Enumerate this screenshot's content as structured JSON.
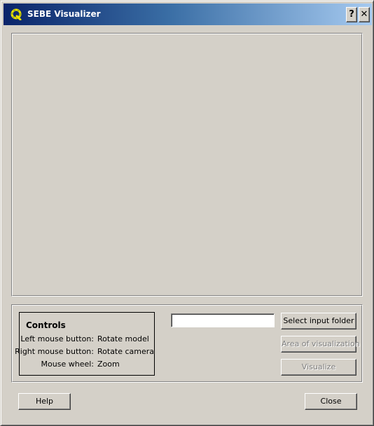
{
  "window": {
    "title": "SEBE Visualizer",
    "help_glyph": "?",
    "close_glyph": "✕"
  },
  "controls": {
    "title": "Controls",
    "rows": [
      {
        "key": "Left mouse button:",
        "value": "Rotate model"
      },
      {
        "key": "Right mouse button:",
        "value": "Rotate camera"
      },
      {
        "key": "Mouse wheel:",
        "value": "Zoom"
      }
    ]
  },
  "input": {
    "folder_path": "",
    "placeholder": ""
  },
  "buttons": {
    "select_input_folder": "Select input folder",
    "area_of_visualization": "Area of visualization",
    "visualize": "Visualize",
    "help": "Help",
    "close": "Close"
  },
  "icons": {
    "app": "qgis-app-icon"
  },
  "colors": {
    "title_gradient_start": "#0a246a",
    "title_gradient_end": "#a6caf0",
    "face": "#d4d0c8",
    "disabled_text": "#808080"
  }
}
